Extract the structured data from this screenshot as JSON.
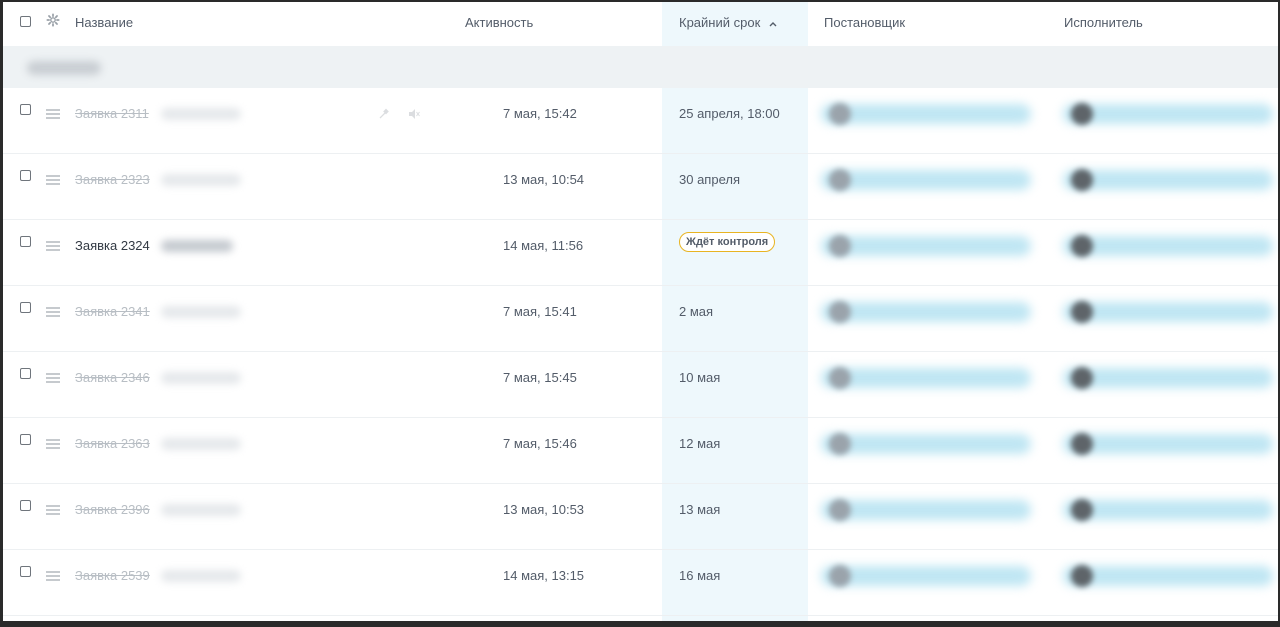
{
  "header": {
    "name_col": "Название",
    "activity_col": "Активность",
    "deadline_col": "Крайний срок",
    "creator_col": "Постановщик",
    "assignee_col": "Исполнитель"
  },
  "rows": [
    {
      "title": "Заявка 2311",
      "activity": "7 мая, 15:42",
      "deadline": "25 апреля, 18:00",
      "completed": true
    },
    {
      "title": "Заявка 2323",
      "activity": "13 мая, 10:54",
      "deadline": "30 апреля",
      "completed": true
    },
    {
      "title": "Заявка 2324",
      "activity": "14 мая, 11:56",
      "deadline": "Ждёт контроля",
      "completed": false,
      "deadline_is_badge": true
    },
    {
      "title": "Заявка 2341",
      "activity": "7 мая, 15:41",
      "deadline": "2 мая",
      "completed": true
    },
    {
      "title": "Заявка 2346",
      "activity": "7 мая, 15:45",
      "deadline": "10 мая",
      "completed": true
    },
    {
      "title": "Заявка 2363",
      "activity": "7 мая, 15:46",
      "deadline": "12 мая",
      "completed": true
    },
    {
      "title": "Заявка 2396",
      "activity": "13 мая, 10:53",
      "deadline": "13 мая",
      "completed": true
    },
    {
      "title": "Заявка 2539",
      "activity": "14 мая, 13:15",
      "deadline": "16 мая",
      "completed": true
    }
  ],
  "colors": {
    "deadline_column_bg": "#eef8fc",
    "badge_border": "#e8b422",
    "completed_text": "#b8bec4",
    "person_blur": "#bfe6f3"
  },
  "icons": [
    "settings-gear-icon",
    "sort-ascending-icon",
    "drag-handle-icon",
    "pin-icon",
    "mute-icon"
  ]
}
